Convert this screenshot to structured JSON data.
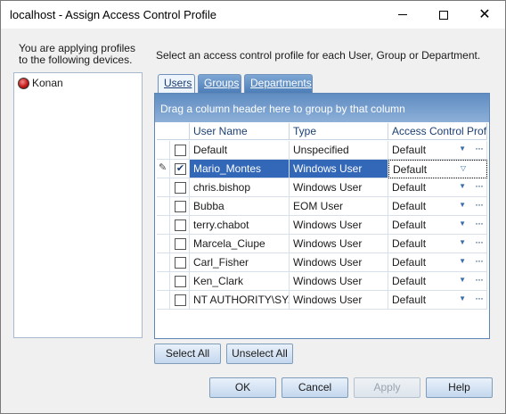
{
  "window": {
    "title": "localhost - Assign Access Control Profile",
    "minimize_glyph": "",
    "maximize_glyph": "",
    "close_glyph": "✕"
  },
  "left_panel": {
    "intro": "You are applying profiles to the following devices.",
    "devices": [
      {
        "name": "Konan",
        "icon": "device-red-icon"
      }
    ]
  },
  "right_panel": {
    "intro": "Select an access control profile for each User, Group or Department."
  },
  "tabs": [
    {
      "label": "Users",
      "active": true
    },
    {
      "label": "Groups",
      "active": false
    },
    {
      "label": "Departments",
      "active": false
    }
  ],
  "grid": {
    "group_panel_text": "Drag a column header here to group by that column",
    "columns": [
      "User Name",
      "Type",
      "Access Control Profile"
    ],
    "rows": [
      {
        "checked": false,
        "name": "Default",
        "type": "Unspecified",
        "profile": "Default",
        "selected": false
      },
      {
        "checked": true,
        "name": "Mario_Montes",
        "type": "Windows User",
        "profile": "Default",
        "selected": true
      },
      {
        "checked": false,
        "name": "chris.bishop",
        "type": "Windows User",
        "profile": "Default",
        "selected": false
      },
      {
        "checked": false,
        "name": "Bubba",
        "type": "EOM User",
        "profile": "Default",
        "selected": false
      },
      {
        "checked": false,
        "name": "terry.chabot",
        "type": "Windows User",
        "profile": "Default",
        "selected": false
      },
      {
        "checked": false,
        "name": "Marcela_Ciupe",
        "type": "Windows User",
        "profile": "Default",
        "selected": false
      },
      {
        "checked": false,
        "name": "Carl_Fisher",
        "type": "Windows User",
        "profile": "Default",
        "selected": false
      },
      {
        "checked": false,
        "name": "Ken_Clark",
        "type": "Windows User",
        "profile": "Default",
        "selected": false
      },
      {
        "checked": false,
        "name": "NT AUTHORITY\\SY...",
        "type": "Windows User",
        "profile": "Default",
        "selected": false
      }
    ],
    "ellipsis_label": "···"
  },
  "selection_buttons": {
    "select_all": "Select All",
    "unselect_all": "Unselect All"
  },
  "dialog_buttons": {
    "ok": "OK",
    "cancel": "Cancel",
    "apply": "Apply",
    "help": "Help"
  },
  "colors": {
    "accent": "#3368b8",
    "group_panel": "#5f8cc2",
    "device_icon": "#c41818"
  }
}
